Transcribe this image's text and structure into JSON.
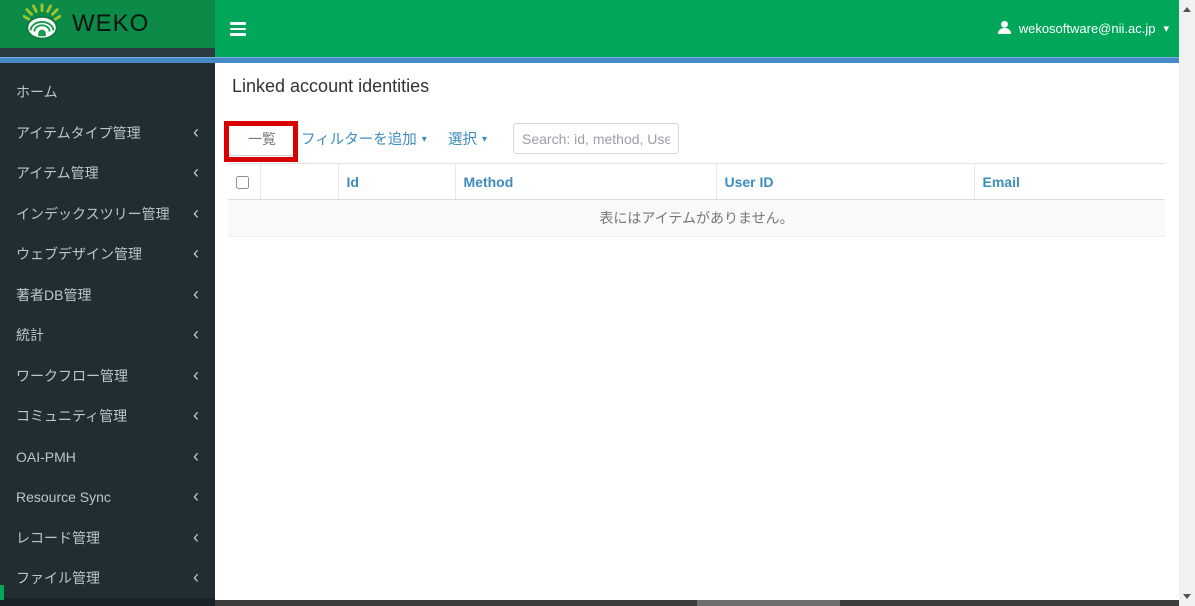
{
  "header": {
    "logo_text": "WEKO",
    "user_email": "wekosoftware@nii.ac.jp"
  },
  "icons": {
    "chevron_left": "‹",
    "caret_down": "▾"
  },
  "sidebar": {
    "items": [
      {
        "label": "ホーム",
        "has_submenu": false
      },
      {
        "label": "アイテムタイプ管理",
        "has_submenu": true
      },
      {
        "label": "アイテム管理",
        "has_submenu": true
      },
      {
        "label": "インデックスツリー管理",
        "has_submenu": true
      },
      {
        "label": "ウェブデザイン管理",
        "has_submenu": true
      },
      {
        "label": "著者DB管理",
        "has_submenu": true
      },
      {
        "label": "統計",
        "has_submenu": true
      },
      {
        "label": "ワークフロー管理",
        "has_submenu": true
      },
      {
        "label": "コミュニティ管理",
        "has_submenu": true
      },
      {
        "label": "OAI-PMH",
        "has_submenu": true
      },
      {
        "label": "Resource Sync",
        "has_submenu": true
      },
      {
        "label": "レコード管理",
        "has_submenu": true
      },
      {
        "label": "ファイル管理",
        "has_submenu": true
      }
    ]
  },
  "main": {
    "title": "Linked account identities",
    "toolbar": {
      "list_label": "一覧",
      "add_filter_label": "フィルターを追加",
      "select_label": "選択",
      "search_placeholder": "Search: id, method, User ID"
    },
    "table": {
      "columns": [
        "Id",
        "Method",
        "User ID",
        "Email"
      ],
      "empty_message": "表にはアイテムがありません。"
    }
  },
  "colors": {
    "logo_bg": "#0b8b47",
    "navbar_bg": "#00a65a",
    "sidebar_bg": "#222d32",
    "accent_blue": "#3c8dbc",
    "annotation_red": "#d90000"
  }
}
